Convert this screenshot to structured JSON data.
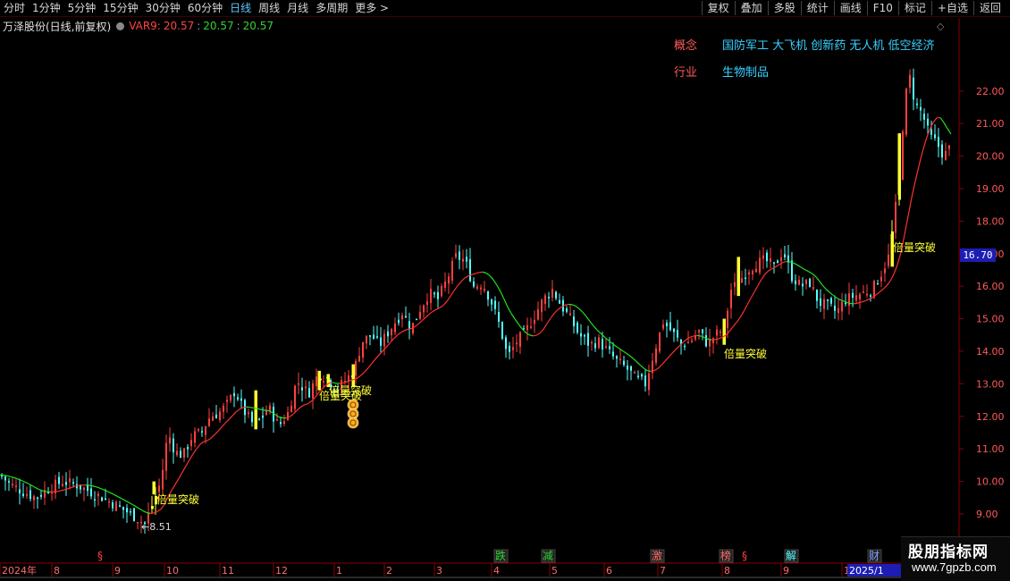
{
  "toolbar": {
    "periods": [
      "分时",
      "1分钟",
      "5分钟",
      "15分钟",
      "30分钟",
      "60分钟",
      "日线",
      "周线",
      "月线",
      "多周期",
      "更多 >"
    ],
    "active_period": "日线",
    "actions": [
      "复权",
      "叠加",
      "多股",
      "统计",
      "画线",
      "F10",
      "标记",
      "+自选",
      "返回"
    ]
  },
  "header": {
    "stock_title": "万泽股份(日线,前复权)",
    "indicator_name": "VAR9:",
    "values": [
      "20.57",
      "20.57",
      "20.57"
    ],
    "separator": ":"
  },
  "panel": {
    "concept_label": "概念",
    "concept_value": "国防军工 大飞机 创新药 无人机 低空经济",
    "industry_label": "行业",
    "industry_value": "生物制品"
  },
  "colors": {
    "up": "#ff4040",
    "down": "#54ffff",
    "ma_rising": "#ff3030",
    "ma_falling": "#20e020",
    "signal_bar": "#ffff30",
    "axis": "#8b0000",
    "price_tag_bg": "#1d1db4"
  },
  "price_tag": "16.70",
  "low_marker": "←8.51",
  "watermark": {
    "title": "股朋指标网",
    "url": "www.7gpzb.com"
  },
  "chart_data": {
    "type": "candlestick",
    "indicator": "VAR9",
    "y_ticks": [
      "9.00",
      "10.00",
      "11.00",
      "12.00",
      "13.00",
      "14.00",
      "15.00",
      "16.00",
      "17.00",
      "18.00",
      "19.00",
      "20.00",
      "21.00",
      "22.00"
    ],
    "x_months": [
      "2024年",
      "8",
      "9",
      "10",
      "11",
      "12",
      "1",
      "2",
      "3",
      "4",
      "5",
      "6",
      "7",
      "8",
      "9",
      "1",
      "2025/1"
    ],
    "close_points": [
      [
        0,
        10.2
      ],
      [
        12,
        9.9
      ],
      [
        25,
        9.7
      ],
      [
        40,
        9.5
      ],
      [
        55,
        9.8
      ],
      [
        70,
        10.0
      ],
      [
        85,
        9.9
      ],
      [
        100,
        9.7
      ],
      [
        115,
        9.5
      ],
      [
        128,
        9.3
      ],
      [
        140,
        9.1
      ],
      [
        152,
        8.9
      ],
      [
        162,
        8.7
      ],
      [
        172,
        9.4
      ],
      [
        180,
        10.0
      ],
      [
        188,
        11.5
      ],
      [
        196,
        10.9
      ],
      [
        205,
        10.8
      ],
      [
        215,
        11.4
      ],
      [
        225,
        11.5
      ],
      [
        235,
        12.0
      ],
      [
        245,
        12.1
      ],
      [
        255,
        12.4
      ],
      [
        263,
        12.8
      ],
      [
        272,
        12.2
      ],
      [
        282,
        11.8
      ],
      [
        292,
        11.9
      ],
      [
        300,
        12.3
      ],
      [
        312,
        11.7
      ],
      [
        322,
        12.1
      ],
      [
        332,
        13.1
      ],
      [
        345,
        12.7
      ],
      [
        356,
        13.3
      ],
      [
        366,
        13.2
      ],
      [
        376,
        12.8
      ],
      [
        386,
        13.1
      ],
      [
        396,
        13.4
      ],
      [
        405,
        14.3
      ],
      [
        415,
        14.5
      ],
      [
        425,
        14.2
      ],
      [
        437,
        14.7
      ],
      [
        450,
        15.2
      ],
      [
        460,
        14.7
      ],
      [
        470,
        15.3
      ],
      [
        480,
        15.8
      ],
      [
        490,
        15.6
      ],
      [
        500,
        16.2
      ],
      [
        510,
        16.9
      ],
      [
        520,
        16.8
      ],
      [
        530,
        16.0
      ],
      [
        540,
        16.1
      ],
      [
        550,
        15.5
      ],
      [
        560,
        14.7
      ],
      [
        568,
        13.8
      ],
      [
        578,
        14.3
      ],
      [
        588,
        14.6
      ],
      [
        598,
        15.1
      ],
      [
        608,
        15.6
      ],
      [
        618,
        15.9
      ],
      [
        628,
        15.4
      ],
      [
        638,
        15.0
      ],
      [
        648,
        14.5
      ],
      [
        660,
        14.2
      ],
      [
        670,
        14.3
      ],
      [
        680,
        14.0
      ],
      [
        690,
        13.7
      ],
      [
        700,
        13.5
      ],
      [
        710,
        13.2
      ],
      [
        722,
        13.0
      ],
      [
        732,
        14.0
      ],
      [
        742,
        14.9
      ],
      [
        752,
        14.6
      ],
      [
        762,
        14.2
      ],
      [
        772,
        14.3
      ],
      [
        782,
        14.6
      ],
      [
        792,
        14.2
      ],
      [
        800,
        14.5
      ],
      [
        810,
        14.7
      ],
      [
        818,
        15.9
      ],
      [
        826,
        16.1
      ],
      [
        836,
        16.5
      ],
      [
        846,
        16.7
      ],
      [
        856,
        16.8
      ],
      [
        866,
        16.6
      ],
      [
        876,
        17.1
      ],
      [
        886,
        16.3
      ],
      [
        896,
        16.0
      ],
      [
        906,
        16.1
      ],
      [
        916,
        15.5
      ],
      [
        926,
        15.4
      ],
      [
        936,
        15.2
      ],
      [
        946,
        15.6
      ],
      [
        956,
        15.7
      ],
      [
        966,
        15.8
      ],
      [
        976,
        15.9
      ],
      [
        986,
        16.4
      ],
      [
        994,
        16.9
      ],
      [
        1000,
        18.0
      ],
      [
        1006,
        19.3
      ],
      [
        1012,
        21.7
      ],
      [
        1018,
        22.4
      ],
      [
        1024,
        21.6
      ],
      [
        1032,
        21.3
      ],
      [
        1040,
        20.6
      ],
      [
        1048,
        20.4
      ],
      [
        1056,
        20.0
      ],
      [
        1064,
        20.3
      ]
    ],
    "signals": [
      {
        "label": "倍量突破",
        "date_pos": 172
      },
      {
        "label": "倍量突破",
        "date_pos": 360
      },
      {
        "label": "倍量突破",
        "date_pos": 395
      },
      {
        "label": "倍量突破",
        "date_pos": 810
      },
      {
        "label": "倍量突破",
        "date_pos": 1000
      }
    ],
    "event_tags": [
      {
        "label": "§",
        "date_pos": 115,
        "color": "#ff4444"
      },
      {
        "label": "跌",
        "date_pos": 560,
        "color": "#2fd52f"
      },
      {
        "label": "减",
        "date_pos": 613,
        "color": "#2fd52f"
      },
      {
        "label": "激",
        "date_pos": 735,
        "color": "#ff6b6b"
      },
      {
        "label": "榜",
        "date_pos": 812,
        "color": "#ff6b6b"
      },
      {
        "label": "§",
        "date_pos": 836,
        "color": "#ff4444"
      },
      {
        "label": "解",
        "date_pos": 885,
        "color": "#54ffff"
      },
      {
        "label": "财",
        "date_pos": 978,
        "color": "#7fa0ff"
      }
    ]
  }
}
